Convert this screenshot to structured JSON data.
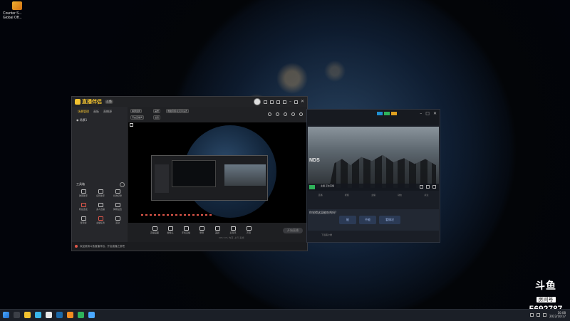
{
  "desktop": {
    "icons": [
      {
        "name": "counter-strike-icon",
        "label_line1": "Counter S...",
        "label_line2": "Global Off..."
      }
    ]
  },
  "app": {
    "logo_text": "直播伴侣",
    "logo_badge": "斗鱼",
    "sidebar_tabs": [
      "场景管理",
      "画板",
      "直播源"
    ],
    "scene_label": "场景1",
    "toolbox_title": "工具箱",
    "tools": [
      "弹幕助手",
      "房管助手",
      "礼物记录",
      "粉丝连麦",
      "多人直播",
      "弹幕设置",
      "游戏榜",
      "主播任务",
      "活动"
    ],
    "topbar_tags": [
      "横屏竖屏",
      "画质",
      "电脑音频/麦克风设置",
      "开启直播间",
      "设置"
    ],
    "controls": [
      "直播画面",
      "摄像头",
      "手机直播",
      "录屏",
      "美颜",
      "麦克风",
      "声音"
    ],
    "start_label": "开始直播",
    "stats_text": "CPU 0%  内存  上行  丢帧",
    "status_text": "欢迎使用斗鱼直播伴侣，开启直播之旅吧"
  },
  "game_window": {
    "banner_text": "NDS",
    "live_info": "主播 正在直播",
    "tabs": [
      "直播",
      "视频",
      "主播",
      "动态",
      "关注"
    ],
    "vote_question": "你觉得这局能吃鸡吗?",
    "vote_options": [
      "能",
      "不能",
      "看情况"
    ],
    "bottom_label": "下载客户端"
  },
  "watermark": {
    "brand": "斗鱼",
    "sub": "房间号",
    "room_number": "5692787"
  },
  "taskbar": {
    "time": "10:08",
    "date": "2022/10/17"
  },
  "colors": {
    "accent": "#f2c230",
    "live_green": "#2fb35a",
    "alert_red": "#e0574a"
  }
}
